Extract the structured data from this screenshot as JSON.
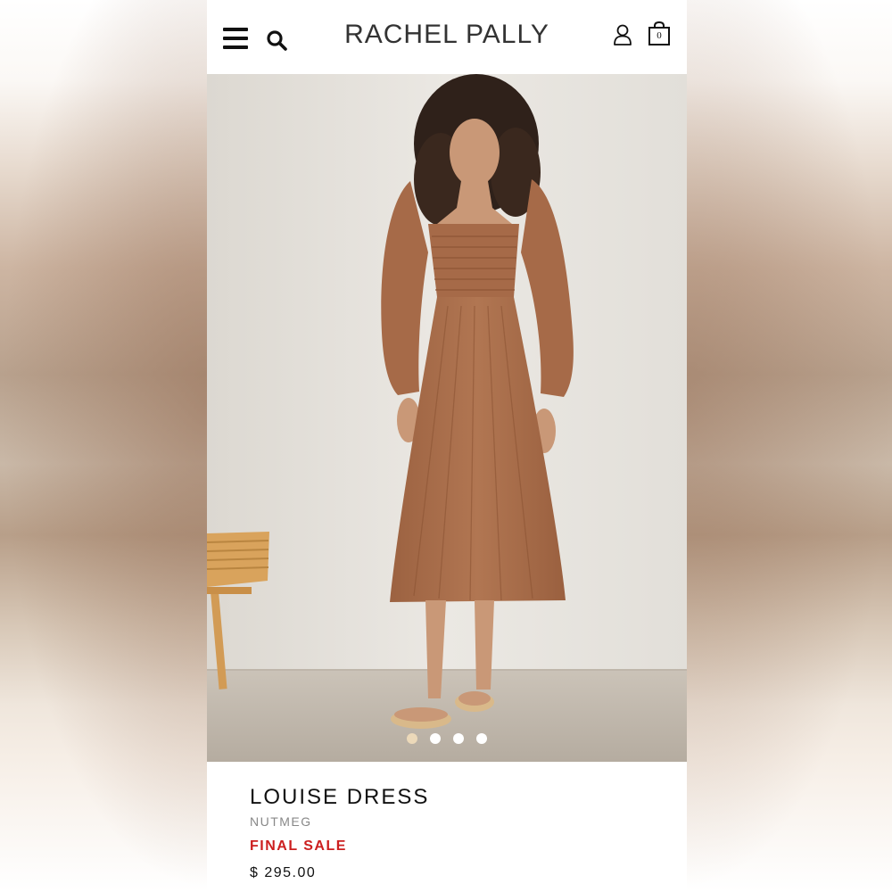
{
  "header": {
    "brand": "RACHEL PALLY",
    "menu_icon": "hamburger-menu-icon",
    "search_icon": "search-icon",
    "account_icon": "user-account-icon",
    "cart_icon": "shopping-bag-icon",
    "cart_count": "0"
  },
  "gallery": {
    "slide_count": 4,
    "active_slide": 1
  },
  "product": {
    "name": "LOUISE DRESS",
    "color": "NUTMEG",
    "sale_label": "FINAL SALE",
    "price": "$ 295.00"
  },
  "colors": {
    "sale_red": "#cc1f1f",
    "dress": "#a86d4a",
    "active_dot": "#ecd9b9"
  }
}
